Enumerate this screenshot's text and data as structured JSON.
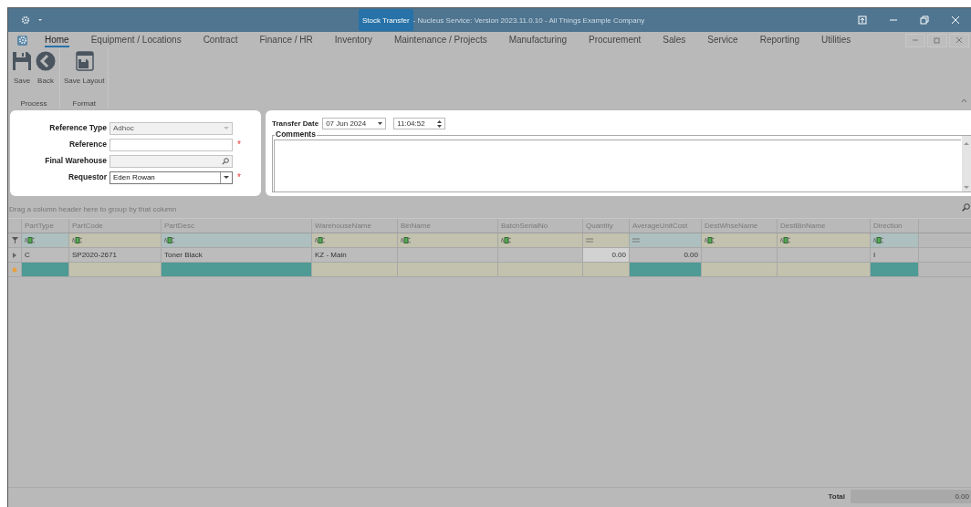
{
  "window": {
    "title": "Stock Transfer",
    "subtitle": " - Nucleus Service: Version 2023.11.0.10 - All Things Example Company"
  },
  "menu": {
    "tabs": [
      {
        "label": "Home",
        "selected": true
      },
      {
        "label": "Equipment / Locations",
        "selected": false
      },
      {
        "label": "Contract",
        "selected": false
      },
      {
        "label": "Finance / HR",
        "selected": false
      },
      {
        "label": "Inventory",
        "selected": false
      },
      {
        "label": "Maintenance / Projects",
        "selected": false
      },
      {
        "label": "Manufacturing",
        "selected": false
      },
      {
        "label": "Procurement",
        "selected": false
      },
      {
        "label": "Sales",
        "selected": false
      },
      {
        "label": "Service",
        "selected": false
      },
      {
        "label": "Reporting",
        "selected": false
      },
      {
        "label": "Utilities",
        "selected": false
      }
    ]
  },
  "ribbon": {
    "groups": [
      {
        "label": "Process",
        "buttons": [
          {
            "label": "Save",
            "kind": "save"
          },
          {
            "label": "Back",
            "kind": "back"
          }
        ]
      },
      {
        "label": "Format",
        "buttons": [
          {
            "label": "Save Layout",
            "kind": "layout"
          }
        ]
      }
    ]
  },
  "form": {
    "fields": [
      {
        "label": "Reference Type",
        "kind": "combo",
        "value": "Adhoc",
        "disabled": true
      },
      {
        "label": "Reference",
        "kind": "text",
        "disabled": false,
        "required_mark": "*"
      },
      {
        "label": "Final Warehouse",
        "kind": "search",
        "disabled": true
      },
      {
        "label": "Requestor",
        "kind": "dropdown",
        "value": "Eden Rowan",
        "disabled": false,
        "required_mark": "*"
      }
    ],
    "transfer_date": {
      "label": "Transfer Date",
      "date": "07 Jun 2024",
      "time": "11:04:52"
    },
    "comments": {
      "label": "Comments"
    }
  },
  "grid": {
    "group_hint": "Drag a column header here to group by that column",
    "columns": [
      {
        "name": "PartType",
        "kind": "text",
        "highlighted": true,
        "editable": false
      },
      {
        "name": "PartCode",
        "kind": "text",
        "highlighted": false,
        "editable": false
      },
      {
        "name": "PartDesc",
        "kind": "text",
        "highlighted": true,
        "editable": false
      },
      {
        "name": "WarehouseName",
        "kind": "text",
        "highlighted": false,
        "editable": false
      },
      {
        "name": "BinName",
        "kind": "text",
        "highlighted": false,
        "editable": false
      },
      {
        "name": "BatchSerialNo",
        "kind": "text",
        "highlighted": false,
        "editable": false
      },
      {
        "name": "Quantity",
        "kind": "number",
        "highlighted": false,
        "editable": true
      },
      {
        "name": "AverageUnitCost",
        "kind": "number",
        "highlighted": true,
        "editable": false
      },
      {
        "name": "DestWhseName",
        "kind": "text",
        "highlighted": false,
        "editable": false
      },
      {
        "name": "DestBinName",
        "kind": "text",
        "highlighted": false,
        "editable": false
      },
      {
        "name": "Direction",
        "kind": "text",
        "highlighted": true,
        "editable": false
      }
    ],
    "rows": [
      {
        "cells": [
          "C",
          "SP2020-2671",
          "Toner Black",
          "KZ - Main",
          "",
          "",
          "0.00",
          "0.00",
          "",
          "",
          "I"
        ]
      }
    ],
    "total": {
      "label": "Total",
      "value": "0.00"
    }
  }
}
